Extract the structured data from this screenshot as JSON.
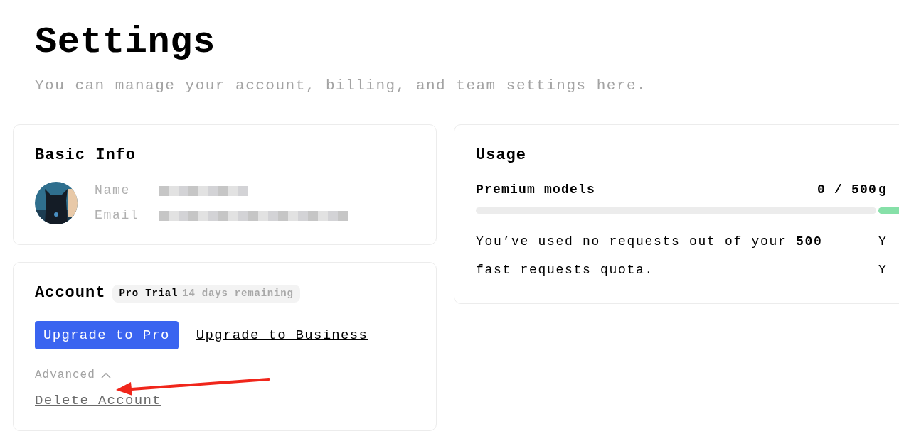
{
  "page": {
    "title": "Settings",
    "subtitle": "You can manage your account, billing, and team settings here."
  },
  "basic_info": {
    "title": "Basic Info",
    "fields": [
      {
        "label": "Name"
      },
      {
        "label": "Email"
      }
    ]
  },
  "account": {
    "title": "Account",
    "badge": {
      "plan": "Pro Trial",
      "remaining": "14 days remaining"
    },
    "primary_button": "Upgrade to Pro",
    "link": "Upgrade to Business",
    "advanced": {
      "label": "Advanced",
      "expanded": true
    },
    "delete_link": "Delete Account"
  },
  "usage": {
    "title": "Usage",
    "meters": [
      {
        "kind": "empty",
        "label": "Premium models",
        "count": "0 / 500",
        "description": "You’ve used no requests out of your **500** fast requests quota."
      },
      {
        "kind": "filled",
        "label": "g",
        "lines": [
          "Y",
          "Y"
        ]
      }
    ]
  }
}
